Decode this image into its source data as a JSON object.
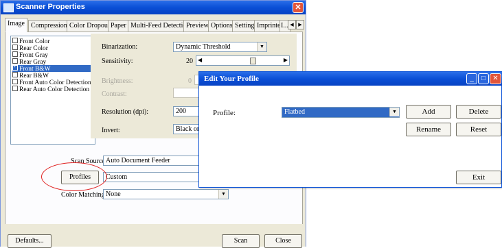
{
  "scanner_window": {
    "title": "Scanner Properties",
    "close_glyph": "✕",
    "tabs": [
      "Image",
      "Compression",
      "Color Dropout",
      "Paper",
      "Multi-Feed Detection",
      "Preview",
      "Options",
      "Setting",
      "Imprinter",
      "I..."
    ],
    "tab_scroll_left": "◀",
    "tab_scroll_right": "▶",
    "image_list": [
      {
        "label": "Front Color",
        "checked": false,
        "selected": false
      },
      {
        "label": "Rear Color",
        "checked": false,
        "selected": false
      },
      {
        "label": "Front Gray",
        "checked": false,
        "selected": false
      },
      {
        "label": "Rear Gray",
        "checked": false,
        "selected": false
      },
      {
        "label": "Front B&W",
        "checked": true,
        "selected": true
      },
      {
        "label": "Rear B&W",
        "checked": false,
        "selected": false
      },
      {
        "label": "Front Auto Color Detection",
        "checked": false,
        "selected": false
      },
      {
        "label": "Rear Auto Color Detection",
        "checked": false,
        "selected": false
      }
    ],
    "settings": {
      "binarization_label": "Binarization:",
      "binarization_value": "Dynamic Threshold",
      "sensitivity_label": "Sensitivity:",
      "sensitivity_value": "20",
      "brightness_label": "Brightness:",
      "brightness_value": "0",
      "contrast_label": "Contrast:",
      "resolution_label": "Resolution (dpi):",
      "resolution_value": "200",
      "invert_label": "Invert:",
      "invert_value": "Black on W"
    },
    "scan_source_label": "Scan Source:",
    "scan_source_value": "Auto Document Feeder",
    "profiles_button": "Profiles",
    "profiles_value": "Custom",
    "color_matching_label": "Color Matching:",
    "color_matching_value": "None",
    "defaults_button": "Defaults...",
    "scan_button": "Scan",
    "close_button": "Close"
  },
  "profile_dialog": {
    "title": "Edit Your Profile",
    "minimize_glyph": "_",
    "maximize_glyph": "□",
    "close_glyph": "✕",
    "profile_label": "Profile:",
    "profile_value": "Flatbed",
    "add_button": "Add",
    "delete_button": "Delete",
    "rename_button": "Rename",
    "reset_button": "Reset",
    "exit_button": "Exit"
  },
  "colors": {
    "title_bar": "#0a4fd6",
    "dialog_face": "#ece9d8",
    "selection": "#316ac5",
    "highlight_circle": "#e02020"
  }
}
